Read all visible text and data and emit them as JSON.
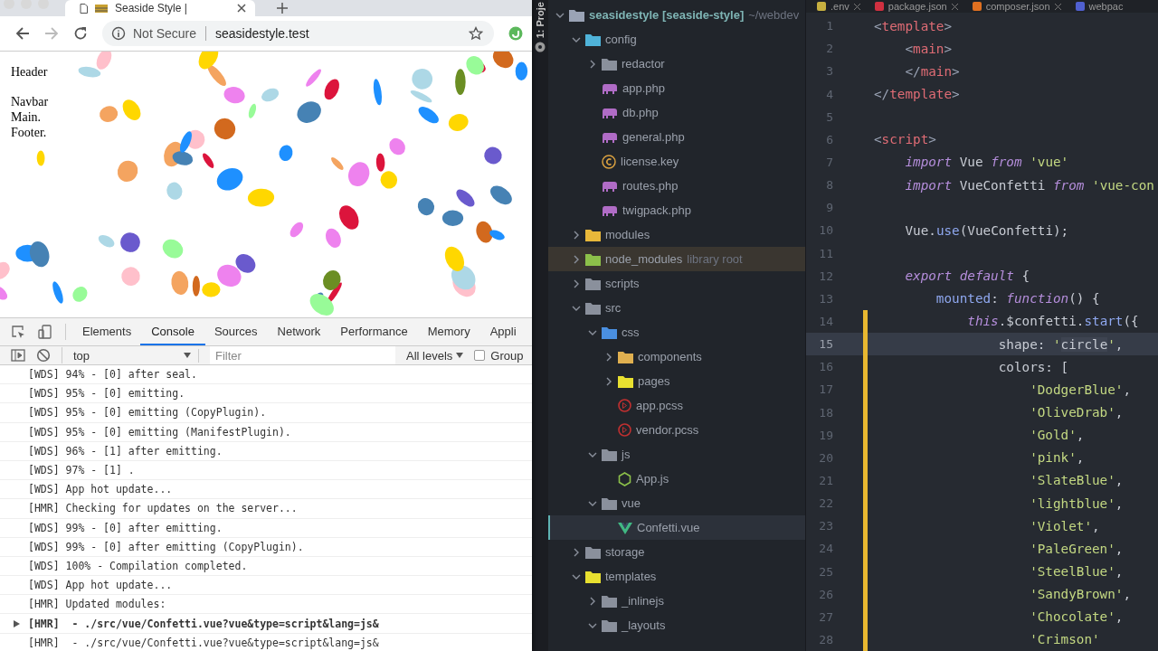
{
  "browser": {
    "tab": {
      "title": "Seaside Style |"
    },
    "address": {
      "security": "Not Secure",
      "url": "seasidestyle.test"
    },
    "page": {
      "blocks": [
        {
          "lines": [
            "Header"
          ]
        },
        {
          "lines": [
            "Navbar",
            "Main.",
            "Footer."
          ]
        }
      ]
    },
    "devtools": {
      "tabs": [
        {
          "label": "Elements",
          "selected": false
        },
        {
          "label": "Console",
          "selected": true
        },
        {
          "label": "Sources",
          "selected": false
        },
        {
          "label": "Network",
          "selected": false
        },
        {
          "label": "Performance",
          "selected": false
        },
        {
          "label": "Memory",
          "selected": false
        },
        {
          "label": "Appli",
          "selected": false
        }
      ],
      "context": "top",
      "filter": {
        "placeholder": "Filter"
      },
      "levels": "All levels",
      "group": {
        "label": "Group",
        "checked": false
      },
      "console": [
        {
          "kind": "log",
          "text": "[WDS] 94% - [0] after seal."
        },
        {
          "kind": "log",
          "text": "[WDS] 95% - [0] emitting."
        },
        {
          "kind": "log",
          "text": "[WDS] 95% - [0] emitting (CopyPlugin)."
        },
        {
          "kind": "log",
          "text": "[WDS] 95% - [0] emitting (ManifestPlugin)."
        },
        {
          "kind": "log",
          "text": "[WDS] 96% - [1] after emitting."
        },
        {
          "kind": "log",
          "text": "[WDS] 97% - [1] ."
        },
        {
          "kind": "log",
          "text": "[WDS] App hot update..."
        },
        {
          "kind": "log",
          "text": "[HMR] Checking for updates on the server..."
        },
        {
          "kind": "log",
          "text": "[WDS] 99% - [0] after emitting."
        },
        {
          "kind": "log",
          "text": "[WDS] 99% - [0] after emitting (CopyPlugin)."
        },
        {
          "kind": "log",
          "text": "[WDS] 100% - Compilation completed."
        },
        {
          "kind": "log",
          "text": "[WDS] App hot update..."
        },
        {
          "kind": "log",
          "text": "[HMR] Updated modules:"
        },
        {
          "kind": "group",
          "text": "[HMR]  - ./src/vue/Confetti.vue?vue&type=script&lang=js&"
        },
        {
          "kind": "log",
          "text": "[HMR]  - ./src/vue/Confetti.vue?vue&type=script&lang=js&"
        }
      ]
    }
  },
  "ide": {
    "sidebar_label": "1: Proje",
    "project": {
      "tree": [
        {
          "name": "seasidestyle [seaside-style]",
          "path": "~/webdev",
          "kind": "folder",
          "color": "#9aa3b5",
          "expanded": true,
          "selected": false,
          "children": [
            {
              "name": "config",
              "kind": "folder",
              "color": "#4fb3d9",
              "expanded": true,
              "selected": false,
              "children": [
                {
                  "name": "redactor",
                  "kind": "folder",
                  "color": "#8a909c",
                  "expanded": false,
                  "selected": false
                },
                {
                  "name": "app.php",
                  "kind": "php",
                  "selected": false
                },
                {
                  "name": "db.php",
                  "kind": "php",
                  "selected": false
                },
                {
                  "name": "general.php",
                  "kind": "php",
                  "selected": false
                },
                {
                  "name": "license.key",
                  "kind": "key",
                  "selected": false
                },
                {
                  "name": "routes.php",
                  "kind": "php",
                  "selected": false
                },
                {
                  "name": "twigpack.php",
                  "kind": "php",
                  "selected": false
                }
              ]
            },
            {
              "name": "modules",
              "kind": "folder",
              "color": "#e8b83a",
              "expanded": false,
              "selected": false
            },
            {
              "name": "node_modules",
              "tag": "library root",
              "kind": "folder",
              "color": "#8cc04a",
              "expanded": false,
              "selected": false
            },
            {
              "name": "scripts",
              "kind": "folder",
              "color": "#8a909c",
              "expanded": false,
              "selected": false
            },
            {
              "name": "src",
              "kind": "folder",
              "color": "#8a909c",
              "expanded": true,
              "selected": false,
              "children": [
                {
                  "name": "css",
                  "kind": "folder",
                  "color": "#4a8fe0",
                  "expanded": true,
                  "selected": false,
                  "children": [
                    {
                      "name": "components",
                      "kind": "folder",
                      "color": "#e0b050",
                      "expanded": false,
                      "selected": false
                    },
                    {
                      "name": "pages",
                      "kind": "folder",
                      "color": "#e8e030",
                      "expanded": false,
                      "selected": false
                    },
                    {
                      "name": "app.pcss",
                      "kind": "pcss",
                      "selected": false
                    },
                    {
                      "name": "vendor.pcss",
                      "kind": "pcss",
                      "selected": false
                    }
                  ]
                },
                {
                  "name": "js",
                  "kind": "folder",
                  "color": "#8a909c",
                  "expanded": true,
                  "selected": false,
                  "children": [
                    {
                      "name": "App.js",
                      "kind": "js",
                      "selected": false
                    }
                  ]
                },
                {
                  "name": "vue",
                  "kind": "folder",
                  "color": "#8a909c",
                  "expanded": true,
                  "selected": false,
                  "children": [
                    {
                      "name": "Confetti.vue",
                      "kind": "vue",
                      "selected": true
                    }
                  ]
                }
              ]
            },
            {
              "name": "storage",
              "kind": "folder",
              "color": "#8a909c",
              "expanded": false,
              "selected": false
            },
            {
              "name": "templates",
              "kind": "folder",
              "color": "#e8e030",
              "expanded": true,
              "selected": false,
              "children": [
                {
                  "name": "_inlinejs",
                  "kind": "folder",
                  "color": "#8a909c",
                  "expanded": false,
                  "selected": false
                },
                {
                  "name": "_layouts",
                  "kind": "folder",
                  "color": "#8a909c",
                  "expanded": true,
                  "selected": false
                }
              ]
            }
          ]
        }
      ]
    },
    "editor": {
      "tabs": [
        {
          "label": ".env",
          "color": "#c8b040"
        },
        {
          "label": "package.json",
          "color": "#d03040"
        },
        {
          "label": "composer.json",
          "color": "#e07020"
        },
        {
          "label": "webpac",
          "color": "#5060d0"
        }
      ],
      "lines": [
        {
          "number": "1",
          "current": false,
          "changed": false,
          "tokens": [
            {
              "kind": "punct",
              "text": "<"
            },
            {
              "kind": "tag",
              "text": "template"
            },
            {
              "kind": "punct",
              "text": ">"
            }
          ]
        },
        {
          "number": "2",
          "current": false,
          "changed": false,
          "tokens": [
            {
              "kind": "punct",
              "text": "    <"
            },
            {
              "kind": "tag",
              "text": "main"
            },
            {
              "kind": "punct",
              "text": ">"
            }
          ]
        },
        {
          "number": "3",
          "current": false,
          "changed": false,
          "tokens": [
            {
              "kind": "punct",
              "text": "    </"
            },
            {
              "kind": "tag",
              "text": "main"
            },
            {
              "kind": "punct",
              "text": ">"
            }
          ]
        },
        {
          "number": "4",
          "current": false,
          "changed": false,
          "tokens": [
            {
              "kind": "punct",
              "text": "</"
            },
            {
              "kind": "tag",
              "text": "template"
            },
            {
              "kind": "punct",
              "text": ">"
            }
          ]
        },
        {
          "number": "5",
          "current": false,
          "changed": false
        },
        {
          "number": "6",
          "current": false,
          "changed": false,
          "tokens": [
            {
              "kind": "punct",
              "text": "<"
            },
            {
              "kind": "tag",
              "text": "script"
            },
            {
              "kind": "punct",
              "text": ">"
            }
          ]
        },
        {
          "number": "7",
          "current": false,
          "changed": false,
          "tokens": [
            {
              "kind": "kw",
              "text": "    import"
            },
            {
              "kind": "plain",
              "text": " Vue "
            },
            {
              "kind": "kw",
              "text": "from"
            },
            {
              "kind": "str",
              "text": " 'vue'"
            }
          ]
        },
        {
          "number": "8",
          "current": false,
          "changed": false,
          "tokens": [
            {
              "kind": "kw",
              "text": "    import"
            },
            {
              "kind": "plain",
              "text": " VueConfetti "
            },
            {
              "kind": "kw",
              "text": "from"
            },
            {
              "kind": "str",
              "text": " 'vue-con"
            }
          ]
        },
        {
          "number": "9",
          "current": false,
          "changed": false
        },
        {
          "number": "10",
          "current": false,
          "changed": false,
          "tokens": [
            {
              "kind": "plain",
              "text": "    Vue."
            },
            {
              "kind": "fn",
              "text": "use"
            },
            {
              "kind": "plain",
              "text": "(VueConfetti);"
            }
          ]
        },
        {
          "number": "11",
          "current": false,
          "changed": false
        },
        {
          "number": "12",
          "current": false,
          "changed": false,
          "tokens": [
            {
              "kind": "kw",
              "text": "    export default"
            },
            {
              "kind": "plain",
              "text": " {"
            }
          ]
        },
        {
          "number": "13",
          "current": false,
          "changed": false,
          "tokens": [
            {
              "kind": "fn",
              "text": "        mounted"
            },
            {
              "kind": "plain",
              "text": ": "
            },
            {
              "kind": "kw",
              "text": "function"
            },
            {
              "kind": "plain",
              "text": "() {"
            }
          ]
        },
        {
          "number": "14",
          "current": false,
          "changed": true,
          "tokens": [
            {
              "kind": "kw",
              "text": "            this"
            },
            {
              "kind": "plain",
              "text": ".$confetti."
            },
            {
              "kind": "fn",
              "text": "start"
            },
            {
              "kind": "plain",
              "text": "({"
            }
          ]
        },
        {
          "number": "15",
          "current": true,
          "changed": true,
          "tokens": [
            {
              "kind": "plain",
              "text": "                shape: "
            },
            {
              "kind": "str",
              "text": "'"
            },
            {
              "kind": "sel",
              "text": "circle"
            },
            {
              "kind": "str",
              "text": "'"
            },
            {
              "kind": "plain",
              "text": ","
            }
          ]
        },
        {
          "number": "16",
          "current": false,
          "changed": true,
          "tokens": [
            {
              "kind": "plain",
              "text": "                colors: ["
            }
          ]
        },
        {
          "number": "17",
          "current": false,
          "changed": true,
          "tokens": [
            {
              "kind": "str",
              "text": "                    'DodgerBlue'"
            },
            {
              "kind": "plain",
              "text": ","
            }
          ]
        },
        {
          "number": "18",
          "current": false,
          "changed": true,
          "tokens": [
            {
              "kind": "str",
              "text": "                    'OliveDrab'"
            },
            {
              "kind": "plain",
              "text": ","
            }
          ]
        },
        {
          "number": "19",
          "current": false,
          "changed": true,
          "tokens": [
            {
              "kind": "str",
              "text": "                    'Gold'"
            },
            {
              "kind": "plain",
              "text": ","
            }
          ]
        },
        {
          "number": "20",
          "current": false,
          "changed": true,
          "tokens": [
            {
              "kind": "str",
              "text": "                    'pink'"
            },
            {
              "kind": "plain",
              "text": ","
            }
          ]
        },
        {
          "number": "21",
          "current": false,
          "changed": true,
          "tokens": [
            {
              "kind": "str",
              "text": "                    'SlateBlue'"
            },
            {
              "kind": "plain",
              "text": ","
            }
          ]
        },
        {
          "number": "22",
          "current": false,
          "changed": true,
          "tokens": [
            {
              "kind": "str",
              "text": "                    'lightblue'"
            },
            {
              "kind": "plain",
              "text": ","
            }
          ]
        },
        {
          "number": "23",
          "current": false,
          "changed": true,
          "tokens": [
            {
              "kind": "str",
              "text": "                    'Violet'"
            },
            {
              "kind": "plain",
              "text": ","
            }
          ]
        },
        {
          "number": "24",
          "current": false,
          "changed": true,
          "tokens": [
            {
              "kind": "str",
              "text": "                    'PaleGreen'"
            },
            {
              "kind": "plain",
              "text": ","
            }
          ]
        },
        {
          "number": "25",
          "current": false,
          "changed": true,
          "tokens": [
            {
              "kind": "str",
              "text": "                    'SteelBlue'"
            },
            {
              "kind": "plain",
              "text": ","
            }
          ]
        },
        {
          "number": "26",
          "current": false,
          "changed": true,
          "tokens": [
            {
              "kind": "str",
              "text": "                    'SandyBrown'"
            },
            {
              "kind": "plain",
              "text": ","
            }
          ]
        },
        {
          "number": "27",
          "current": false,
          "changed": true,
          "tokens": [
            {
              "kind": "str",
              "text": "                    'Chocolate'"
            },
            {
              "kind": "plain",
              "text": ","
            }
          ]
        },
        {
          "number": "28",
          "current": false,
          "changed": true,
          "tokens": [
            {
              "kind": "str",
              "text": "                    'Crimson'"
            }
          ]
        }
      ]
    }
  }
}
